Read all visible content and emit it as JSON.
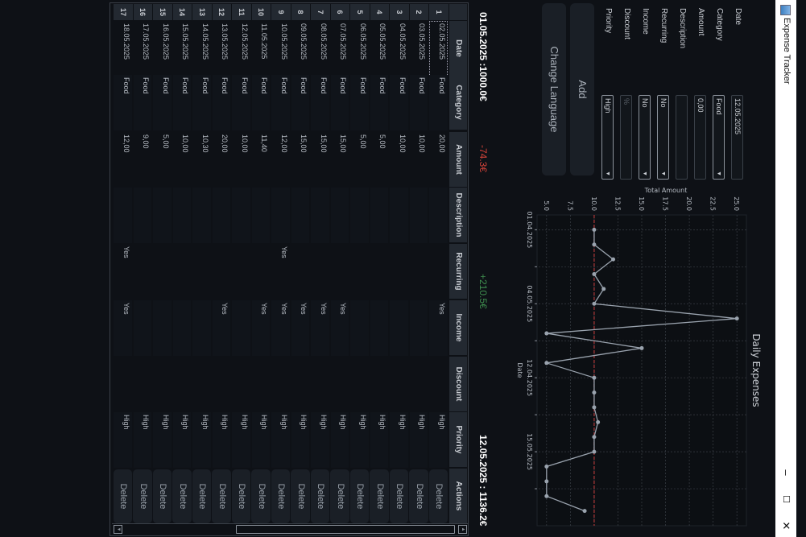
{
  "window": {
    "title": "Expense Tracker",
    "icon": "app-icon",
    "controls": {
      "minimize": "–",
      "maximize": "☐",
      "close": "✕"
    }
  },
  "form": {
    "fields": [
      {
        "label": "Date",
        "value": "12.05.2025",
        "type": "text"
      },
      {
        "label": "Category",
        "value": "Food",
        "type": "select"
      },
      {
        "label": "Amount",
        "value": "0,00",
        "type": "text"
      },
      {
        "label": "Description",
        "value": "",
        "type": "text"
      },
      {
        "label": "Recurring",
        "value": "No",
        "type": "select"
      },
      {
        "label": "Income",
        "value": "No",
        "type": "select"
      },
      {
        "label": "Discount",
        "value": "",
        "placeholder": "%",
        "type": "text"
      },
      {
        "label": "Priority",
        "value": "High",
        "type": "select"
      }
    ],
    "add_label": "Add",
    "change_language_label": "Change Language"
  },
  "summary": {
    "start": "01.05.2025 :1000.0€",
    "expenses": "-74.3€",
    "income": "+210.5€",
    "end": "12.05.2025 : 1136.2€",
    "colors": {
      "expenses": "#d9443a",
      "income": "#3f8f4f"
    }
  },
  "chart_data": {
    "type": "line",
    "title": "Daily Expenses",
    "xlabel": "Date",
    "ylabel": "Total Amount",
    "x_tick_labels": [
      "01.04.2025",
      "04.05.2025",
      "12.04.2025",
      "15.05.2025"
    ],
    "x_tick_label_positions": [
      0,
      5,
      10,
      15
    ],
    "values": [
      10,
      10,
      12,
      10,
      11,
      10,
      25,
      5,
      15,
      5,
      10,
      10,
      10,
      10.4,
      10,
      10,
      5,
      5,
      5,
      9
    ],
    "yticks": [
      "5.0",
      "7.5",
      "10.0",
      "12.5",
      "15.0",
      "17.5",
      "20.0",
      "22.5",
      "25.0"
    ],
    "ylim": [
      4,
      26
    ],
    "reference_line": 10,
    "grid": true,
    "colors": {
      "line": "#9aa3ae",
      "reference": "#b03a3a"
    }
  },
  "table": {
    "columns": [
      "Date",
      "Category",
      "Amount",
      "Description",
      "Recurring",
      "Income",
      "Discount",
      "Priority",
      "Actions"
    ],
    "delete_label": "Delete",
    "rows": [
      {
        "n": "1",
        "date": "02.05.2025",
        "category": "Food",
        "amount": "20,00",
        "description": "",
        "recurring": "",
        "income": "Yes",
        "discount": "",
        "priority": "High"
      },
      {
        "n": "2",
        "date": "03.05.2025",
        "category": "Food",
        "amount": "10,00",
        "description": "",
        "recurring": "",
        "income": "",
        "discount": "",
        "priority": "High"
      },
      {
        "n": "3",
        "date": "04.05.2025",
        "category": "Food",
        "amount": "10,00",
        "description": "",
        "recurring": "",
        "income": "",
        "discount": "",
        "priority": "High"
      },
      {
        "n": "4",
        "date": "05.05.2025",
        "category": "Food",
        "amount": "5,00",
        "description": "",
        "recurring": "",
        "income": "",
        "discount": "",
        "priority": "High"
      },
      {
        "n": "5",
        "date": "06.05.2025",
        "category": "Food",
        "amount": "5,00",
        "description": "",
        "recurring": "",
        "income": "",
        "discount": "",
        "priority": "High"
      },
      {
        "n": "6",
        "date": "07.05.2025",
        "category": "Food",
        "amount": "15,00",
        "description": "",
        "recurring": "",
        "income": "Yes",
        "discount": "",
        "priority": "High"
      },
      {
        "n": "7",
        "date": "08.05.2025",
        "category": "Food",
        "amount": "15,00",
        "description": "",
        "recurring": "",
        "income": "Yes",
        "discount": "",
        "priority": "High"
      },
      {
        "n": "8",
        "date": "09.05.2025",
        "category": "Food",
        "amount": "15,00",
        "description": "",
        "recurring": "",
        "income": "Yes",
        "discount": "",
        "priority": "High"
      },
      {
        "n": "9",
        "date": "10.05.2025",
        "category": "Food",
        "amount": "12,00",
        "description": "",
        "recurring": "Yes",
        "income": "Yes",
        "discount": "",
        "priority": "High"
      },
      {
        "n": "10",
        "date": "11.05.2025",
        "category": "Food",
        "amount": "11,40",
        "description": "",
        "recurring": "",
        "income": "Yes",
        "discount": "",
        "priority": "High"
      },
      {
        "n": "11",
        "date": "12.05.2025",
        "category": "Food",
        "amount": "10,00",
        "description": "",
        "recurring": "",
        "income": "",
        "discount": "",
        "priority": "High"
      },
      {
        "n": "12",
        "date": "13.05.2025",
        "category": "Food",
        "amount": "20,00",
        "description": "",
        "recurring": "",
        "income": "Yes",
        "discount": "",
        "priority": "High"
      },
      {
        "n": "13",
        "date": "14.05.2025",
        "category": "Food",
        "amount": "10,30",
        "description": "",
        "recurring": "",
        "income": "",
        "discount": "",
        "priority": "High"
      },
      {
        "n": "14",
        "date": "15.05.2025",
        "category": "Food",
        "amount": "10,00",
        "description": "",
        "recurring": "",
        "income": "",
        "discount": "",
        "priority": "High"
      },
      {
        "n": "15",
        "date": "16.05.2025",
        "category": "Food",
        "amount": "5,00",
        "description": "",
        "recurring": "",
        "income": "",
        "discount": "",
        "priority": "High"
      },
      {
        "n": "16",
        "date": "17.05.2025",
        "category": "Food",
        "amount": "9,00",
        "description": "",
        "recurring": "",
        "income": "",
        "discount": "",
        "priority": "High"
      },
      {
        "n": "17",
        "date": "18.05.2025",
        "category": "Food",
        "amount": "12,00",
        "description": "",
        "recurring": "Yes",
        "income": "Yes",
        "discount": "",
        "priority": "High"
      }
    ]
  }
}
